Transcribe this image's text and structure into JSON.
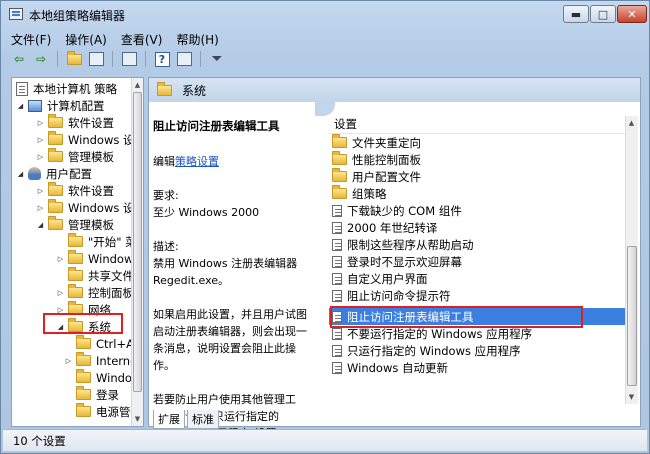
{
  "window": {
    "title": "本地组策略编辑器",
    "min_label": "▬",
    "max_label": "□",
    "close_label": "✕"
  },
  "menu": [
    "文件(F)",
    "操作(A)",
    "查看(V)",
    "帮助(H)"
  ],
  "tree": [
    {
      "label": "本地计算机 策略",
      "icon": "doc-icon"
    },
    {
      "label": "计算机配置",
      "icon": "computer-icon"
    },
    {
      "label": "软件设置",
      "icon": "folder-icon"
    },
    {
      "label": "Windows 设",
      "icon": "folder-icon"
    },
    {
      "label": "管理模板",
      "icon": "folder-icon"
    },
    {
      "label": "用户配置",
      "icon": "user-icon"
    },
    {
      "label": "软件设置",
      "icon": "folder-icon"
    },
    {
      "label": "Windows 设",
      "icon": "folder-icon"
    },
    {
      "label": "管理模板",
      "icon": "folder-icon"
    },
    {
      "label": "\"开始\" 菜",
      "icon": "folder-icon"
    },
    {
      "label": "Windows",
      "icon": "folder-icon"
    },
    {
      "label": "共享文件夹",
      "icon": "folder-icon"
    },
    {
      "label": "控制面板",
      "icon": "folder-icon"
    },
    {
      "label": "网络",
      "icon": "folder-icon"
    },
    {
      "label": "系统",
      "icon": "folder-icon"
    },
    {
      "label": "Ctrl+A",
      "icon": "folder-icon"
    },
    {
      "label": "Interne",
      "icon": "folder-icon"
    },
    {
      "label": "Windo",
      "icon": "folder-icon"
    },
    {
      "label": "登录",
      "icon": "folder-icon"
    },
    {
      "label": "电源管",
      "icon": "folder-icon"
    }
  ],
  "right_header": "系统",
  "description": {
    "title": "阻止访问注册表编辑工具",
    "edit_prefix": "编辑",
    "edit_link": "策略设置",
    "req_label": "要求:",
    "req_value": "至少 Windows 2000",
    "desc_label": "描述:",
    "desc_text": "禁用 Windows 注册表编辑器 Regedit.exe。",
    "para1": "如果启用此设置，并且用户试图启动注册表编辑器，则会出现一条消息，说明设置会阻止此操作。",
    "para2": "若要防止用户使用其他管理工具，请使用\"只运行指定的 Windows 应用程序\"设置。"
  },
  "list": {
    "column_header": "设置",
    "items": [
      {
        "label": "文件夹重定向",
        "icon": "folder-icon"
      },
      {
        "label": "性能控制面板",
        "icon": "folder-icon"
      },
      {
        "label": "用户配置文件",
        "icon": "folder-icon"
      },
      {
        "label": "组策略",
        "icon": "folder-icon"
      },
      {
        "label": "下载缺少的 COM 组件",
        "icon": "setting-icon"
      },
      {
        "label": "2000 年世纪转译",
        "icon": "setting-icon"
      },
      {
        "label": "限制这些程序从帮助启动",
        "icon": "setting-icon"
      },
      {
        "label": "登录时不显示欢迎屏幕",
        "icon": "setting-icon"
      },
      {
        "label": "自定义用户界面",
        "icon": "setting-icon"
      },
      {
        "label": "阻止访问命令提示符",
        "icon": "setting-icon"
      },
      {
        "label": "阻止访问注册表编辑工具",
        "icon": "setting-icon",
        "selected": true
      },
      {
        "label": "不要运行指定的 Windows 应用程序",
        "icon": "setting-icon"
      },
      {
        "label": "只运行指定的 Windows 应用程序",
        "icon": "setting-icon"
      },
      {
        "label": "Windows 自动更新",
        "icon": "setting-icon"
      }
    ]
  },
  "tabs": [
    "扩展",
    "标准"
  ],
  "status": "10 个设置",
  "colors": {
    "highlight": "#e02020",
    "selection": "#3b7fe0"
  }
}
